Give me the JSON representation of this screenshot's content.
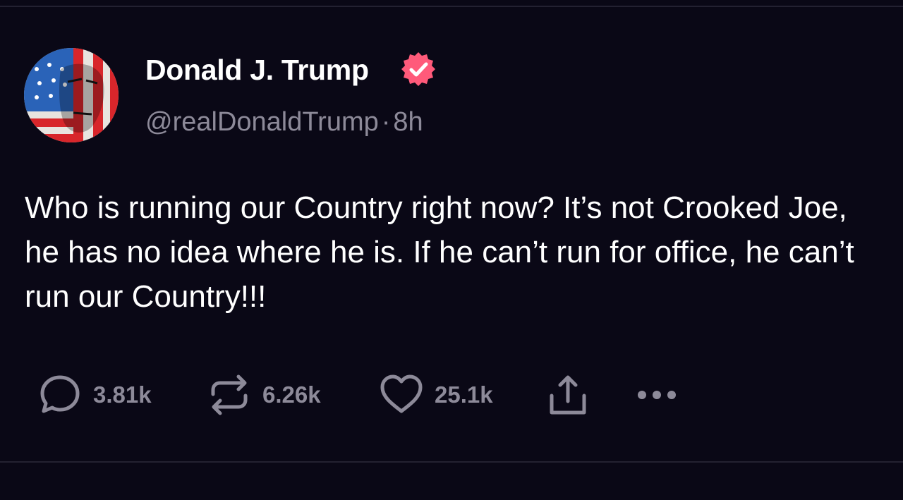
{
  "post": {
    "author": {
      "display_name": "Donald J. Trump",
      "handle": "@realDonaldTrump",
      "separator": "·",
      "time": "8h",
      "avatar_icon": "flag-portrait-avatar",
      "verified_icon": "verified-badge-icon"
    },
    "text": "Who is running our Country right now? It’s not Crooked Joe, he has no idea where he is. If he can’t run for office, he can’t run our Country!!!",
    "actions": {
      "replies": "3.81k",
      "reposts": "6.26k",
      "likes": "25.1k",
      "share_icon": "share-icon",
      "more_icon": "more-icon"
    }
  },
  "colors": {
    "background": "#0a0816",
    "text_primary": "#ffffff",
    "text_secondary": "#8d8a99",
    "verified_badge": "#ff5a7a",
    "divider": "#232131"
  }
}
